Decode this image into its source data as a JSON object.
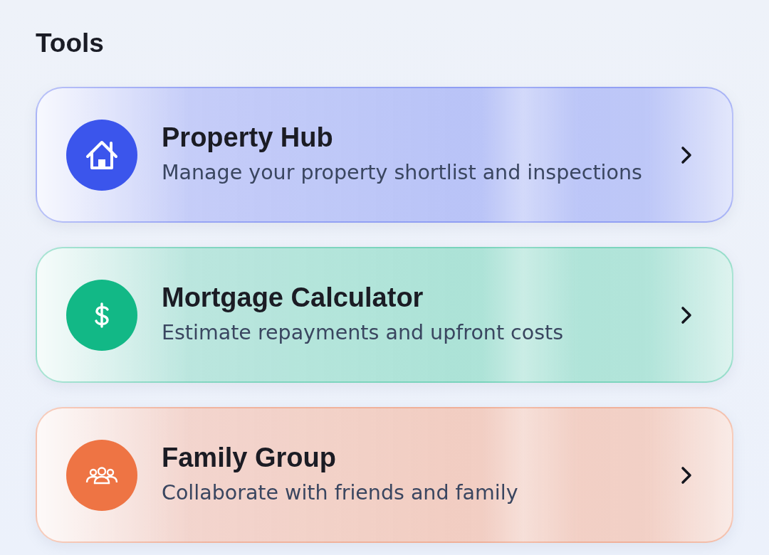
{
  "section": {
    "title": "Tools"
  },
  "tools": [
    {
      "kind": "home",
      "color": "#3b55ec",
      "title": "Property Hub",
      "description": "Manage your property shortlist and inspections"
    },
    {
      "kind": "dollar",
      "color": "#12b886",
      "title": "Mortgage Calculator",
      "description": "Estimate repayments and upfront costs"
    },
    {
      "kind": "people",
      "color": "#ee7444",
      "title": "Family Group",
      "description": "Collaborate with friends and family"
    }
  ]
}
